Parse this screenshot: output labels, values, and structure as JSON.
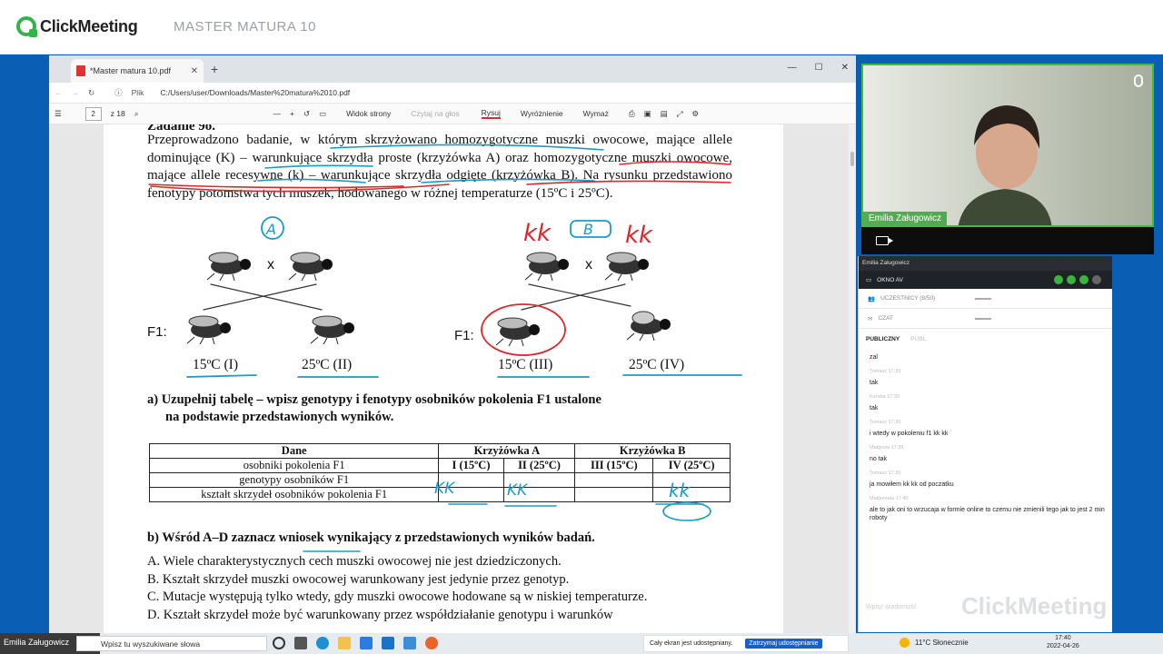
{
  "app": {
    "brand": "ClickMeeting",
    "meeting_title": "MASTER MATURA 10"
  },
  "browser": {
    "tab_title": "*Master matura 10.pdf",
    "address_label": "Plik",
    "url": "C:/Users/user/Downloads/Master%20matura%2010.pdf",
    "page_current": "2",
    "page_total": "z 18",
    "toolbar": {
      "page_view": "Widok strony",
      "read_aloud": "Czytaj na głos",
      "draw": "Rysuj",
      "highlight": "Wyróżnienie",
      "erase": "Wymaż"
    }
  },
  "document": {
    "heading_fragment": "Zadanie 9o.",
    "paragraph": "Przeprowadzono badanie, w którym skrzyżowano homozygotyczne muszki owocowe, mające allele dominujące (K) – warunkujące skrzydła proste (krzyżówka A) oraz homozygotyczne muszki owocowe, mające allele recesywne (k) – warunkujące skrzydła odgięte (krzyżówka B). Na rysunku przedstawiono fenotypy potomstwa tych muszek, hodowanego w różnej temperaturze (15ºC i 25ºC).",
    "f1_label": "F1:",
    "cross_symbol": "x",
    "temps": [
      "15ºC (I)",
      "25ºC (II)",
      "15ºC (III)",
      "25ºC (IV)"
    ],
    "question_a_line1": "a) Uzupełnij tabelę – wpisz genotypy i fenotypy osobników pokolenia F1 ustalone",
    "question_a_line2": "na podstawie przedstawionych wyników.",
    "table": {
      "h_dane": "Dane",
      "h_a": "Krzyżówka A",
      "h_b": "Krzyżówka B",
      "row1": "osobniki pokolenia F1",
      "cols": [
        "I (15ºC)",
        "II (25ºC)",
        "III (15ºC)",
        "IV (25ºC)"
      ],
      "row2": "genotypy osobników F1",
      "row3": "kształt skrzydeł osobników pokolenia F1"
    },
    "question_b": "b) Wśród A–D zaznacz wniosek wynikający z przedstawionych wyników badań.",
    "options": [
      "A. Wiele charakterystycznych cech muszki owocowej nie jest dziedziczonych.",
      "B. Kształt skrzydeł muszki owocowej warunkowany jest jedynie przez genotyp.",
      "C. Mutacje występują tylko wtedy, gdy muszki owocowe hodowane są w niskiej temperaturze.",
      "D. Kształt skrzydeł może być warunkowany przez współdziałanie genotypu i warunków"
    ],
    "annotations": {
      "circle_a": "A",
      "box_b": "B",
      "kk_left": "kk",
      "kk_right": "kk",
      "cell_i": "KK",
      "cell_ii": "KK",
      "cell_iv": "kk"
    }
  },
  "video": {
    "presenter": "Emilia Załugowicz"
  },
  "panel": {
    "presenter_small": "Emilia Załugowicz",
    "av_window": "OKNO AV",
    "participants": "UCZESTNICY (8/50)",
    "chat": "CZAT",
    "tab_public": "PUBLICZNY",
    "tab_private": "PUBL",
    "messages": [
      {
        "meta": "",
        "text": "zal"
      },
      {
        "meta": "Tomasz  17:39",
        "text": "tak"
      },
      {
        "meta": "Kendra  17:39",
        "text": "tak"
      },
      {
        "meta": "Tomasz  17:39",
        "text": "i wtedy w pokoleniu f1 kk kk"
      },
      {
        "meta": "Małgosia  17:39",
        "text": "no tak"
      },
      {
        "meta": "Tomasz  17:39",
        "text": "ja mowiłem kk kk od poczatku"
      },
      {
        "meta": "Małgorzata  17:40",
        "text": "ale to jak oni to wrzucaja w formie online to czemu nie zmienili tego jak to jest 2 min roboty"
      }
    ],
    "input_placeholder": "Wpisz wiadomość",
    "watermark": "ClickMeeting"
  },
  "taskbar": {
    "user": "Emilia Załugowicz",
    "search": "Wpisz tu wyszukiwane słowa",
    "share_text": "Cały ekran jest udostępniany.",
    "share_button": "Zatrzymaj udostępnianie",
    "weather": "11°C  Słonecznie",
    "time": "17:40",
    "date": "2022-04-26"
  },
  "colors": {
    "accent": "#34b34a",
    "ink_red": "#e0262a",
    "ink_blue": "#1a9bc7",
    "stage": "#0a5fb4"
  }
}
